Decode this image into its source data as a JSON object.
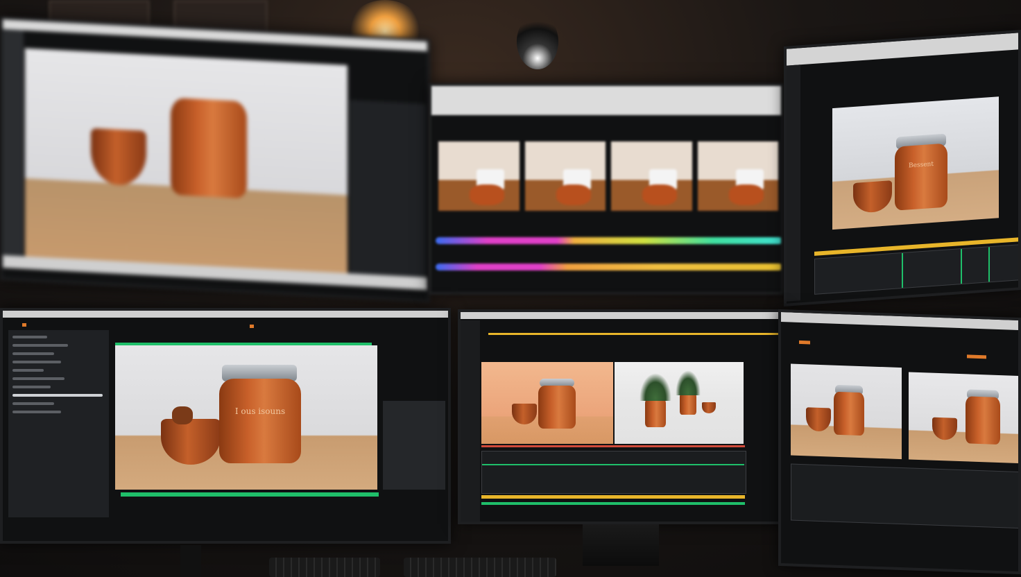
{
  "scene": "multi-monitor video editing workstation",
  "monitors": [
    {
      "id": "top-left",
      "subject": "blurred jar and bowl"
    },
    {
      "id": "top-center",
      "subject": "filmstrip thumbnails and colored timeline tracks"
    },
    {
      "id": "top-right",
      "subject": "jar and bowl preview with green timeline"
    },
    {
      "id": "bottom-left",
      "subject": "jar and bowl preview with project panel",
      "jar_text": "I ous isouns"
    },
    {
      "id": "bottom-center",
      "subject": "jar with bowl and potted plants split view"
    },
    {
      "id": "bottom-right",
      "subject": "two jar previews side by side"
    }
  ],
  "top_right_jar_text": "Bessent",
  "colors": {
    "accent": "#e07a2a",
    "track_green": "#1fbf6a",
    "track_yellow": "#e8b52a",
    "track_magenta": "#e040c8",
    "track_blue": "#3a6cf0",
    "jar_orange": "#c8602a",
    "ui_dark": "#2b2d30"
  }
}
